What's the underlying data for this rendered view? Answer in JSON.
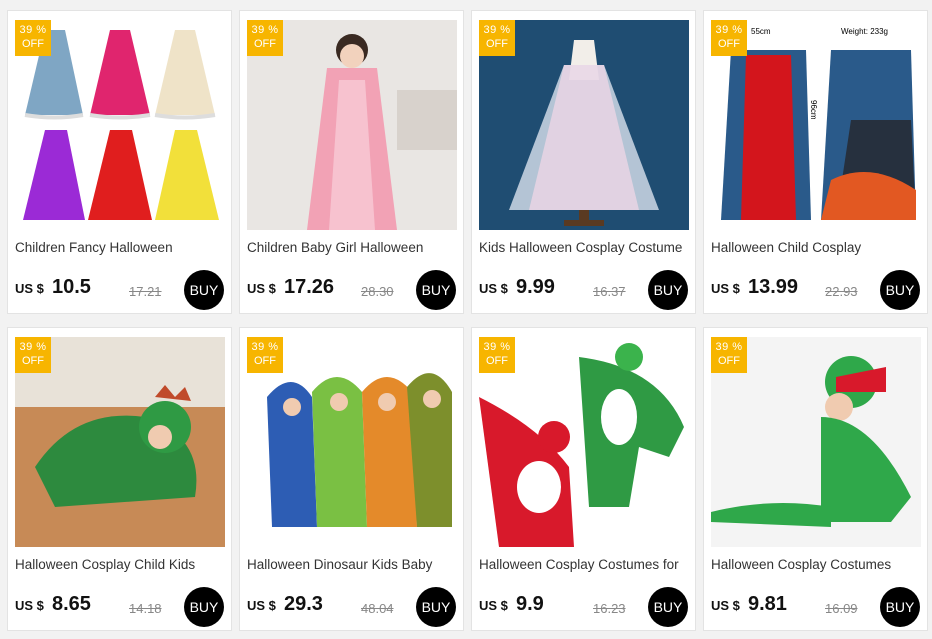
{
  "products": [
    {
      "discount_pct": "39 %",
      "discount_off": "OFF",
      "title": "Children Fancy Halloween",
      "currency": "US $",
      "price": "10.5",
      "original_price": "17.21",
      "buy_label": "BUY",
      "image": "colorful-kids-capes"
    },
    {
      "discount_pct": "39 %",
      "discount_off": "OFF",
      "title": "Children Baby Girl Halloween",
      "currency": "US $",
      "price": "17.26",
      "original_price": "28.30",
      "buy_label": "BUY",
      "image": "pink-princess-cape"
    },
    {
      "discount_pct": "39 %",
      "discount_off": "OFF",
      "title": "Kids Halloween Cosplay Costume",
      "currency": "US $",
      "price": "9.99",
      "original_price": "16.37",
      "buy_label": "BUY",
      "image": "rainbow-tulle-cape"
    },
    {
      "discount_pct": "39 %",
      "discount_off": "OFF",
      "title": "Halloween Child Cosplay",
      "currency": "US $",
      "price": "13.99",
      "original_price": "22.93",
      "buy_label": "BUY",
      "image": "vampire-halloween-cape",
      "size_note_1": "55cm",
      "size_note_2": "96cm",
      "weight_note": "Weight: 233g"
    },
    {
      "discount_pct": "39 %",
      "discount_off": "OFF",
      "title": "Halloween Cosplay Child Kids",
      "currency": "US $",
      "price": "8.65",
      "original_price": "14.18",
      "buy_label": "BUY",
      "image": "green-dragon-onesie"
    },
    {
      "discount_pct": "39 %",
      "discount_off": "OFF",
      "title": "Halloween Dinosaur Kids Baby",
      "currency": "US $",
      "price": "29.3",
      "original_price": "48.04",
      "buy_label": "BUY",
      "image": "dinosaur-costume-group"
    },
    {
      "discount_pct": "39 %",
      "discount_off": "OFF",
      "title": "Halloween Cosplay Costumes for",
      "currency": "US $",
      "price": "9.9",
      "original_price": "16.23",
      "buy_label": "BUY",
      "image": "parrot-bird-costumes"
    },
    {
      "discount_pct": "39 %",
      "discount_off": "OFF",
      "title": "Halloween Cosplay Costumes",
      "currency": "US $",
      "price": "9.81",
      "original_price": "16.09",
      "buy_label": "BUY",
      "image": "crocodile-costume"
    }
  ],
  "colors": {
    "badge": "#f7b500",
    "buy_button": "#000000",
    "background": "#f2f2f2"
  }
}
